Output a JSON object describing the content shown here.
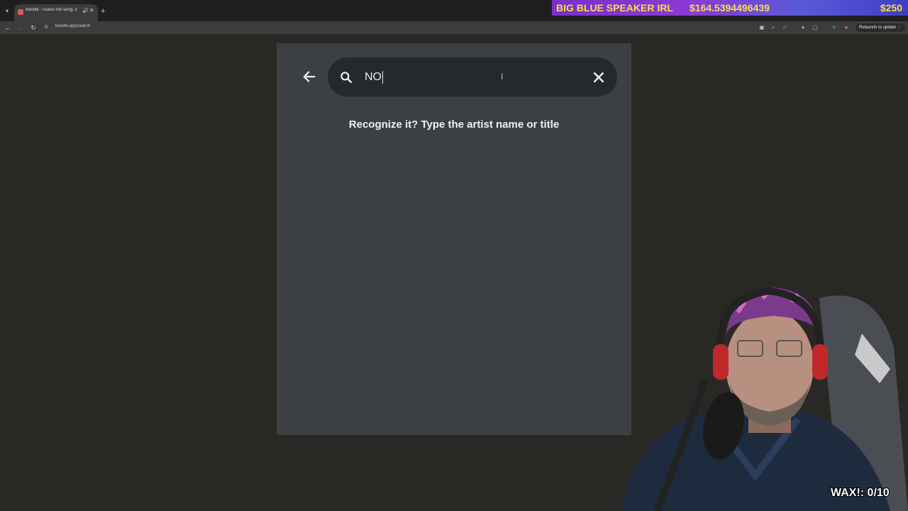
{
  "browser": {
    "tab_title": "Bandle - Guess the song, o",
    "url": "bandle.app/search",
    "relaunch_label": "Relaunch to update"
  },
  "stream_banner": {
    "title": "BIG BLUE SPEAKER IRL",
    "amount": "$164.5394496439",
    "goal": "$250"
  },
  "app": {
    "search": {
      "value": "NO"
    },
    "prompt": "Recognize it? Type the artist name or title"
  },
  "overlay": {
    "score": "WAX!: 0/10"
  },
  "colors": {
    "page_bg": "#2a2824",
    "panel_bg": "#3d4042",
    "search_bg": "#26292b",
    "banner_text": "#f0e050"
  },
  "icons": [
    "chevron-down-icon",
    "favicon-icon",
    "audio-icon",
    "close-icon",
    "plus-icon",
    "back-icon",
    "forward-icon",
    "reload-icon",
    "site-info-icon",
    "screen-icon",
    "zoom-icon",
    "star-icon",
    "extension-icon",
    "arrow-left-icon",
    "search-icon",
    "clear-icon"
  ]
}
